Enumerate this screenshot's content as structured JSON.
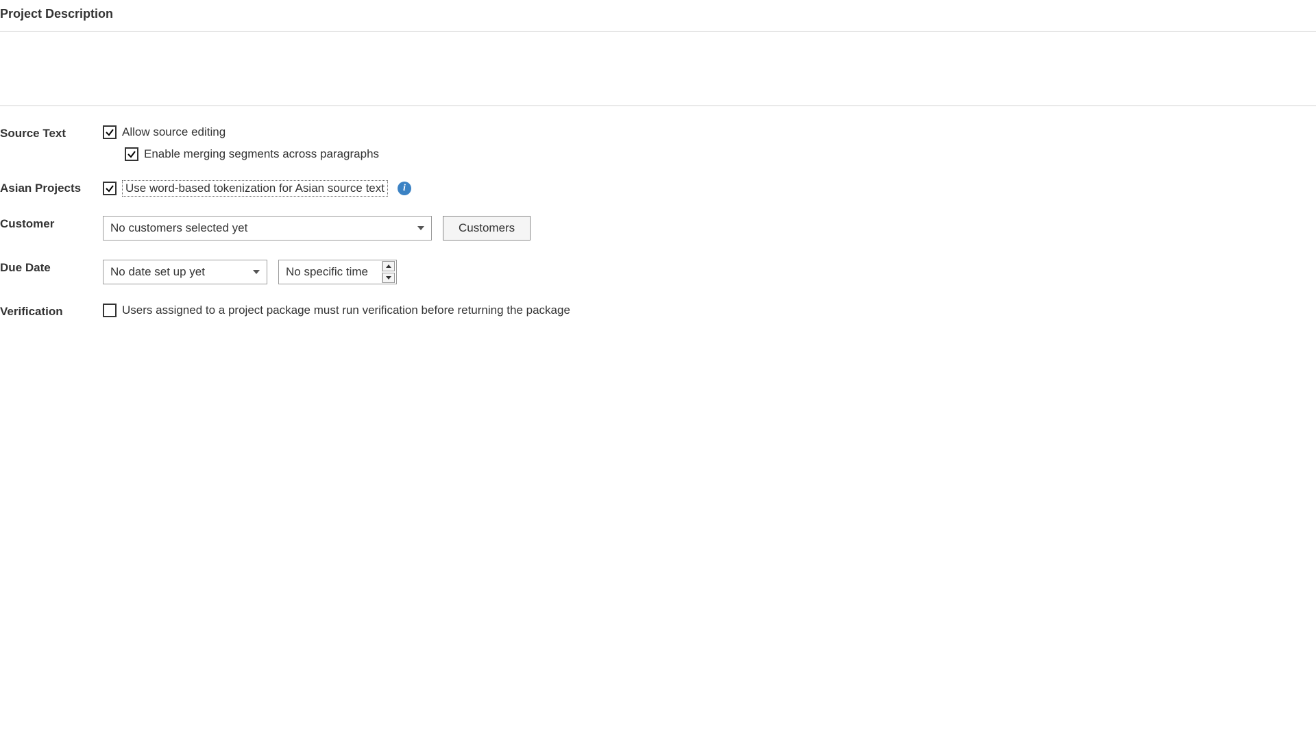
{
  "sections": {
    "project_description_label": "Project Description"
  },
  "source_text": {
    "label": "Source Text",
    "allow_source_editing": {
      "label": "Allow source editing",
      "checked": true
    },
    "enable_merging": {
      "label": "Enable merging segments across paragraphs",
      "checked": true
    }
  },
  "asian_projects": {
    "label": "Asian Projects",
    "word_tokenization": {
      "label": "Use word-based tokenization for Asian source text",
      "checked": true
    }
  },
  "customer": {
    "label": "Customer",
    "dropdown_value": "No customers selected yet",
    "button_label": "Customers"
  },
  "due_date": {
    "label": "Due Date",
    "date_value": "No date set up yet",
    "time_value": "No specific time"
  },
  "verification": {
    "label": "Verification",
    "run_verification": {
      "label": "Users assigned to a project package must run verification before returning the package",
      "checked": false
    }
  }
}
